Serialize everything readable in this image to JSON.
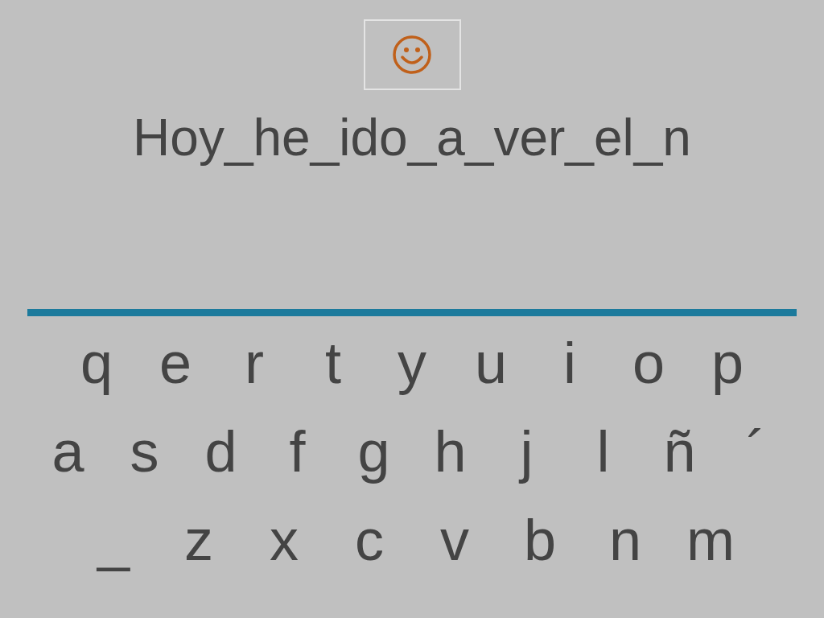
{
  "sentence": "Hoy_he_ido_a_ver_el_n",
  "keyboard_rows": [
    [
      "q",
      "e",
      "r",
      "t",
      "y",
      "u",
      "i",
      "o",
      "p"
    ],
    [
      "a",
      "s",
      "d",
      "f",
      "g",
      "h",
      "j",
      "l",
      "ñ",
      "´"
    ],
    [
      "_",
      "z",
      "x",
      "c",
      "v",
      "b",
      "n",
      "m"
    ]
  ]
}
